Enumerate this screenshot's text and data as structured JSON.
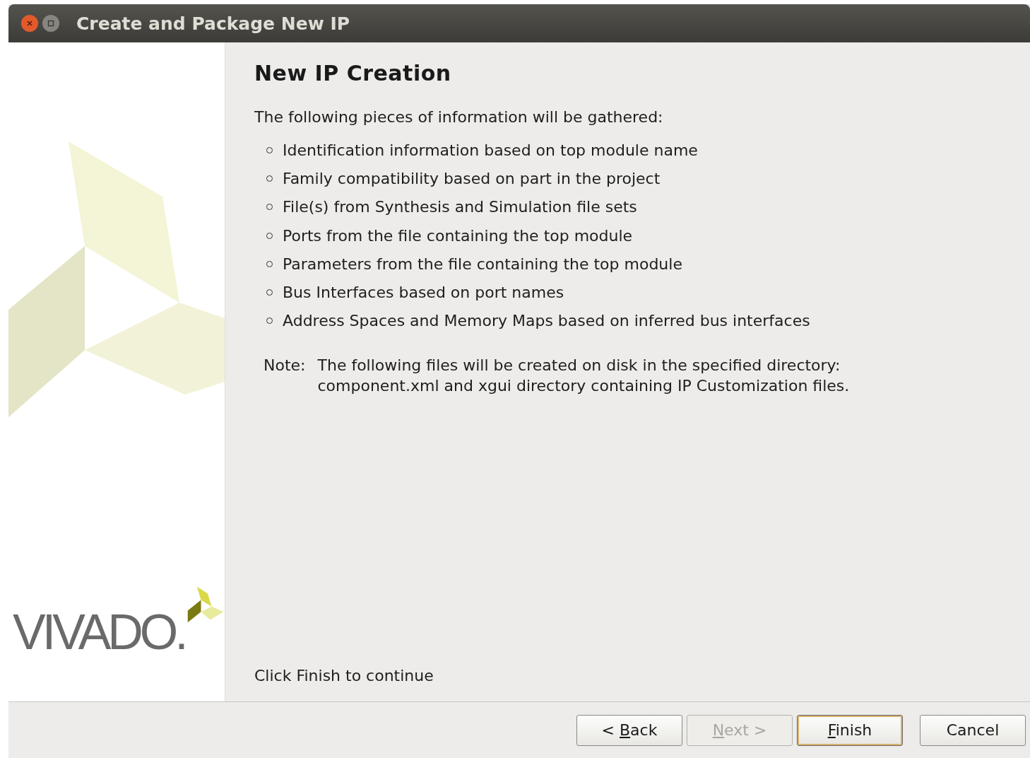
{
  "window": {
    "title": "Create and Package New IP"
  },
  "sidebar": {
    "logo_text": "VIVADO."
  },
  "page": {
    "heading": "New IP Creation",
    "intro": "The following pieces of information will be gathered:",
    "items": [
      "Identification information based on top module name",
      "Family compatibility based on part in the project",
      "File(s) from Synthesis and Simulation file sets",
      "Ports from the file containing the top module",
      "Parameters from the file containing the top module",
      "Bus Interfaces based on port names",
      "Address Spaces and Memory Maps based on inferred bus interfaces"
    ],
    "note_label": "Note:",
    "note_lines": [
      "The following files will be created on disk in the specified directory:",
      "component.xml and xgui directory containing IP Customization files."
    ],
    "footer": "Click Finish to continue"
  },
  "buttons": [
    {
      "label": "< Back",
      "mnemonic_underlined": true,
      "disabled": false,
      "default": false
    },
    {
      "label": "Next >",
      "mnemonic_underlined": true,
      "disabled": true,
      "default": false
    },
    {
      "label": "Finish",
      "mnemonic_underlined": true,
      "disabled": false,
      "default": true
    },
    {
      "label": "Cancel",
      "mnemonic_underlined": false,
      "disabled": false,
      "default": false
    }
  ]
}
